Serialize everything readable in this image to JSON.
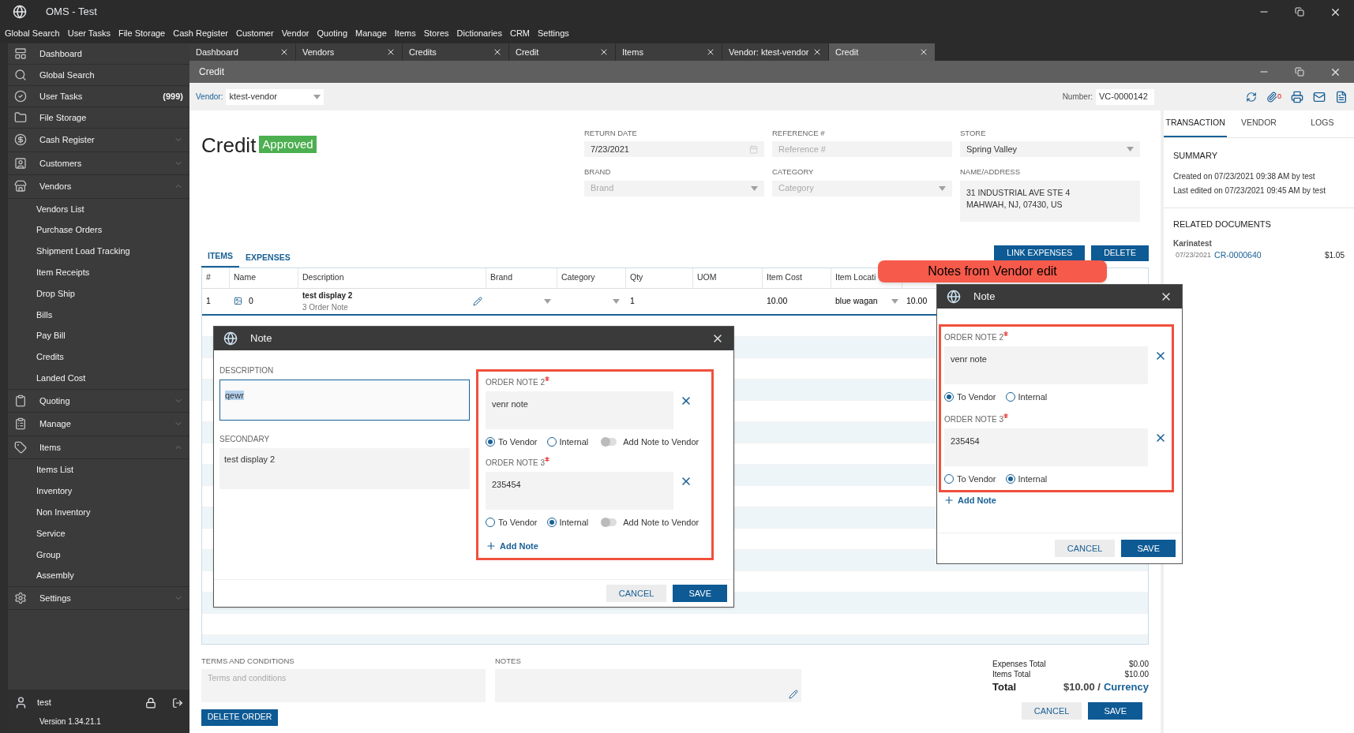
{
  "window": {
    "title": "OMS - Test"
  },
  "menu": [
    "Global Search",
    "User Tasks",
    "File Storage",
    "Cash Register",
    "Customer",
    "Vendor",
    "Quoting",
    "Manage",
    "Items",
    "Stores",
    "Dictionaries",
    "CRM",
    "Settings"
  ],
  "sidebar": {
    "items": [
      {
        "kind": "link",
        "label": "Dashboard"
      },
      {
        "kind": "link",
        "label": "Global Search"
      },
      {
        "kind": "link",
        "label": "User Tasks",
        "count": "(999)"
      },
      {
        "kind": "link",
        "label": "File Storage"
      },
      {
        "kind": "group",
        "label": "Cash Register",
        "expanded": false
      },
      {
        "kind": "group",
        "label": "Customers",
        "expanded": false
      },
      {
        "kind": "group",
        "label": "Vendors",
        "expanded": true,
        "children": [
          {
            "label": "Vendors List"
          },
          {
            "label": "Purchase Orders"
          },
          {
            "label": "Shipment Load Tracking"
          },
          {
            "label": "Item Receipts"
          },
          {
            "label": "Drop Ship"
          },
          {
            "label": "Bills"
          },
          {
            "label": "Pay Bill"
          },
          {
            "label": "Credits"
          },
          {
            "label": "Landed Cost"
          }
        ]
      },
      {
        "kind": "group",
        "label": "Quoting",
        "expanded": false
      },
      {
        "kind": "group",
        "label": "Manage",
        "expanded": false
      },
      {
        "kind": "group",
        "label": "Items",
        "expanded": true,
        "children": [
          {
            "label": "Items List"
          },
          {
            "label": "Inventory"
          },
          {
            "label": "Non Inventory"
          },
          {
            "label": "Service"
          },
          {
            "label": "Group"
          },
          {
            "label": "Assembly"
          }
        ]
      },
      {
        "kind": "group",
        "label": "Settings",
        "expanded": false
      }
    ],
    "user": "test",
    "version": "Version 1.34.21.1"
  },
  "tabs": [
    {
      "label": "Dashboard",
      "selected": false
    },
    {
      "label": "Vendors",
      "selected": false
    },
    {
      "label": "Credits",
      "selected": false
    },
    {
      "label": "Credit",
      "selected": false
    },
    {
      "label": "Items",
      "selected": false
    },
    {
      "label": "Vendor: ktest-vendor",
      "selected": false
    },
    {
      "label": "Credit",
      "selected": true
    }
  ],
  "document": {
    "window_title": "Credit",
    "vendor_label": "Vendor:",
    "vendor": "ktest-vendor",
    "number_label": "Number:",
    "number": "VC-0000142",
    "attachments": "0",
    "title": "Credit",
    "status": "Approved",
    "fields": [
      {
        "label": "RETURN DATE",
        "value": "7/23/2021",
        "kind": "date"
      },
      {
        "label": "REFERENCE #",
        "placeholder": "Reference #",
        "kind": "text"
      },
      {
        "label": "STORE",
        "value": "Spring Valley",
        "kind": "select"
      },
      {
        "label": "BRAND",
        "placeholder": "Brand",
        "kind": "select"
      },
      {
        "label": "CATEGORY",
        "placeholder": "Category",
        "kind": "select"
      },
      {
        "label": "NAME/ADDRESS",
        "lines": [
          "31 INDUSTRIAL AVE STE 4",
          "MAHWAH, NJ, 07430, US"
        ],
        "kind": "address"
      }
    ],
    "section_tabs": [
      {
        "label": "ITEMS",
        "selected": true
      },
      {
        "label": "EXPENSES",
        "selected": false
      }
    ],
    "actions": [
      "LINK EXPENSES",
      "DELETE"
    ],
    "table": {
      "columns": [
        "#",
        "Name",
        "Description",
        "Brand",
        "Category",
        "Qty",
        "UOM",
        "Item Cost",
        "Item Locati"
      ],
      "rows": [
        {
          "index": "1",
          "name": "0",
          "description": "test display 2",
          "note": "3  Order Note",
          "qty": "1",
          "item_cost": "10.00",
          "location": "blue wagan",
          "column_10": "10.00"
        }
      ]
    },
    "terms": {
      "label": "TERMS AND CONDITIONS",
      "placeholder": "Terms and conditions"
    },
    "notes": {
      "label": "NOTES"
    },
    "totals": [
      {
        "label": "Expenses Total",
        "value": "$0.00"
      },
      {
        "label": "Items Total",
        "value": "$10.00"
      }
    ],
    "total": {
      "label": "Total",
      "value": "$10.00 /",
      "currency": "Currency"
    },
    "buttons": {
      "delete": "DELETE ORDER",
      "cancel": "CANCEL",
      "save": "SAVE"
    }
  },
  "side_panel": {
    "tabs": [
      {
        "label": "TRANSACTION",
        "selected": true
      },
      {
        "label": "VENDOR",
        "selected": false
      },
      {
        "label": "LOGS",
        "selected": false
      }
    ],
    "summary_title": "SUMMARY",
    "summary": [
      "Created on 07/23/2021 09:38 AM by test",
      "Last edited on 07/23/2021 09:45 AM by test"
    ],
    "related_title": "RELATED DOCUMENTS",
    "related": [
      {
        "party": "Karinatest",
        "date": "07/23/2021",
        "number": "CR-0000640",
        "amount": "$1.05"
      }
    ]
  },
  "note_dialog": {
    "title": "Note",
    "description_label": "DESCRIPTION",
    "description": "qewr",
    "description_highlighted": true,
    "secondary_label": "SECONDARY",
    "secondary": "test display 2",
    "notes": [
      {
        "label": "ORDER NOTE 2",
        "value": "venr note",
        "options": [
          {
            "label": "To Vendor",
            "selected": true
          },
          {
            "label": "Internal",
            "selected": false
          }
        ],
        "toggle": {
          "label": "Add Note to Vendor",
          "on": false
        }
      },
      {
        "label": "ORDER NOTE 3",
        "value": "235454",
        "options": [
          {
            "label": "To Vendor",
            "selected": false
          },
          {
            "label": "Internal",
            "selected": true
          }
        ],
        "toggle": {
          "label": "Add Note to Vendor",
          "on": false
        }
      }
    ],
    "add": "Add Note",
    "cancel": "CANCEL",
    "save": "SAVE"
  },
  "vendor_note_dialog": {
    "title": "Note",
    "notes": [
      {
        "label": "ORDER NOTE 2",
        "value": "venr note",
        "options": [
          {
            "label": "To Vendor",
            "selected": true
          },
          {
            "label": "Internal",
            "selected": false
          }
        ]
      },
      {
        "label": "ORDER NOTE 3",
        "value": "235454",
        "options": [
          {
            "label": "To Vendor",
            "selected": false
          },
          {
            "label": "Internal",
            "selected": true
          }
        ]
      }
    ],
    "add": "Add Note",
    "cancel": "CANCEL",
    "save": "SAVE"
  },
  "callout": "Notes from Vendor edit"
}
